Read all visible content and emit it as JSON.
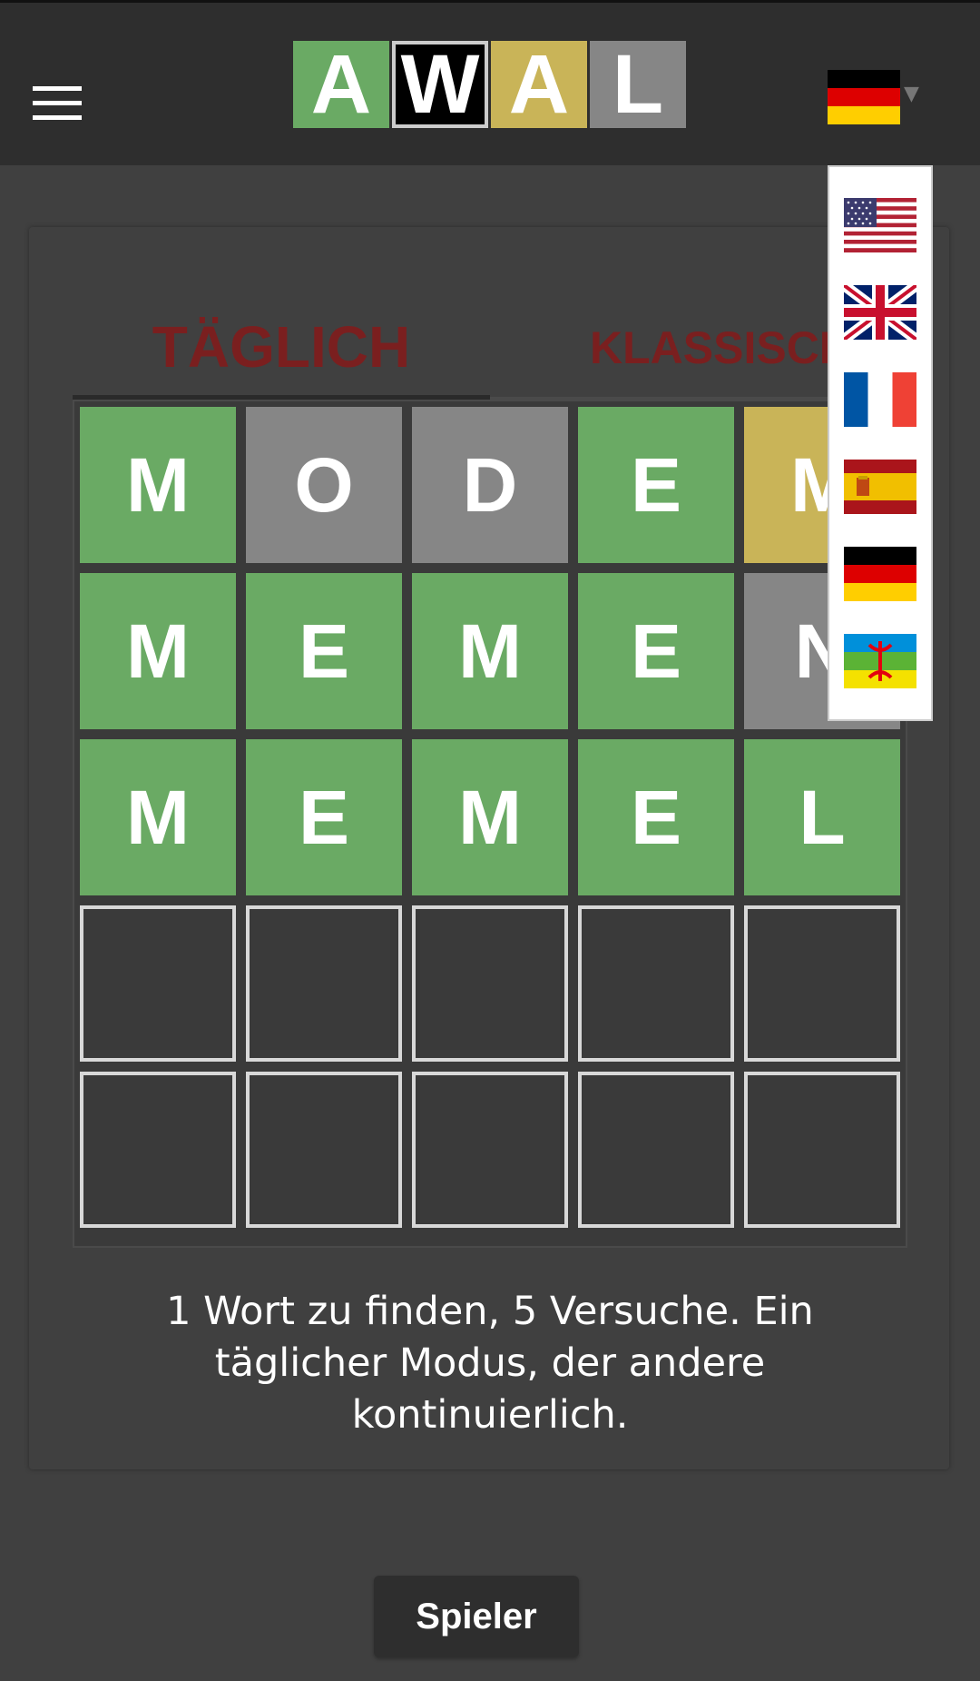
{
  "header": {
    "menu_icon": "hamburger-menu-icon",
    "logo_letters": [
      "A",
      "W",
      "A",
      "L"
    ],
    "current_language_flag": "german-flag-icon"
  },
  "tabs": {
    "daily": "TÄGLICH",
    "classic": "KLASSISCH"
  },
  "board": {
    "rows": [
      [
        {
          "letter": "M",
          "state": "correct"
        },
        {
          "letter": "O",
          "state": "absent"
        },
        {
          "letter": "D",
          "state": "absent"
        },
        {
          "letter": "E",
          "state": "correct"
        },
        {
          "letter": "M",
          "state": "present"
        }
      ],
      [
        {
          "letter": "M",
          "state": "correct"
        },
        {
          "letter": "E",
          "state": "correct"
        },
        {
          "letter": "M",
          "state": "correct"
        },
        {
          "letter": "E",
          "state": "correct"
        },
        {
          "letter": "N",
          "state": "absent"
        }
      ],
      [
        {
          "letter": "M",
          "state": "correct"
        },
        {
          "letter": "E",
          "state": "correct"
        },
        {
          "letter": "M",
          "state": "correct"
        },
        {
          "letter": "E",
          "state": "correct"
        },
        {
          "letter": "L",
          "state": "correct"
        }
      ],
      [
        {
          "letter": "",
          "state": "empty"
        },
        {
          "letter": "",
          "state": "empty"
        },
        {
          "letter": "",
          "state": "empty"
        },
        {
          "letter": "",
          "state": "empty"
        },
        {
          "letter": "",
          "state": "empty"
        }
      ],
      [
        {
          "letter": "",
          "state": "empty"
        },
        {
          "letter": "",
          "state": "empty"
        },
        {
          "letter": "",
          "state": "empty"
        },
        {
          "letter": "",
          "state": "empty"
        },
        {
          "letter": "",
          "state": "empty"
        }
      ]
    ]
  },
  "description": "1 Wort zu finden, 5 Versuche. Ein täglicher Modus, der andere kontinuierlich.",
  "player_button": "Spieler",
  "language_options": [
    "us-flag-icon",
    "uk-flag-icon",
    "france-flag-icon",
    "spain-flag-icon",
    "german-flag-icon",
    "berber-flag-icon"
  ],
  "colors": {
    "correct": "#6aaa64",
    "present": "#c9b458",
    "absent": "#868686",
    "background": "#404040",
    "header": "#2e2e2e",
    "tab_text": "#7a1f1f"
  }
}
